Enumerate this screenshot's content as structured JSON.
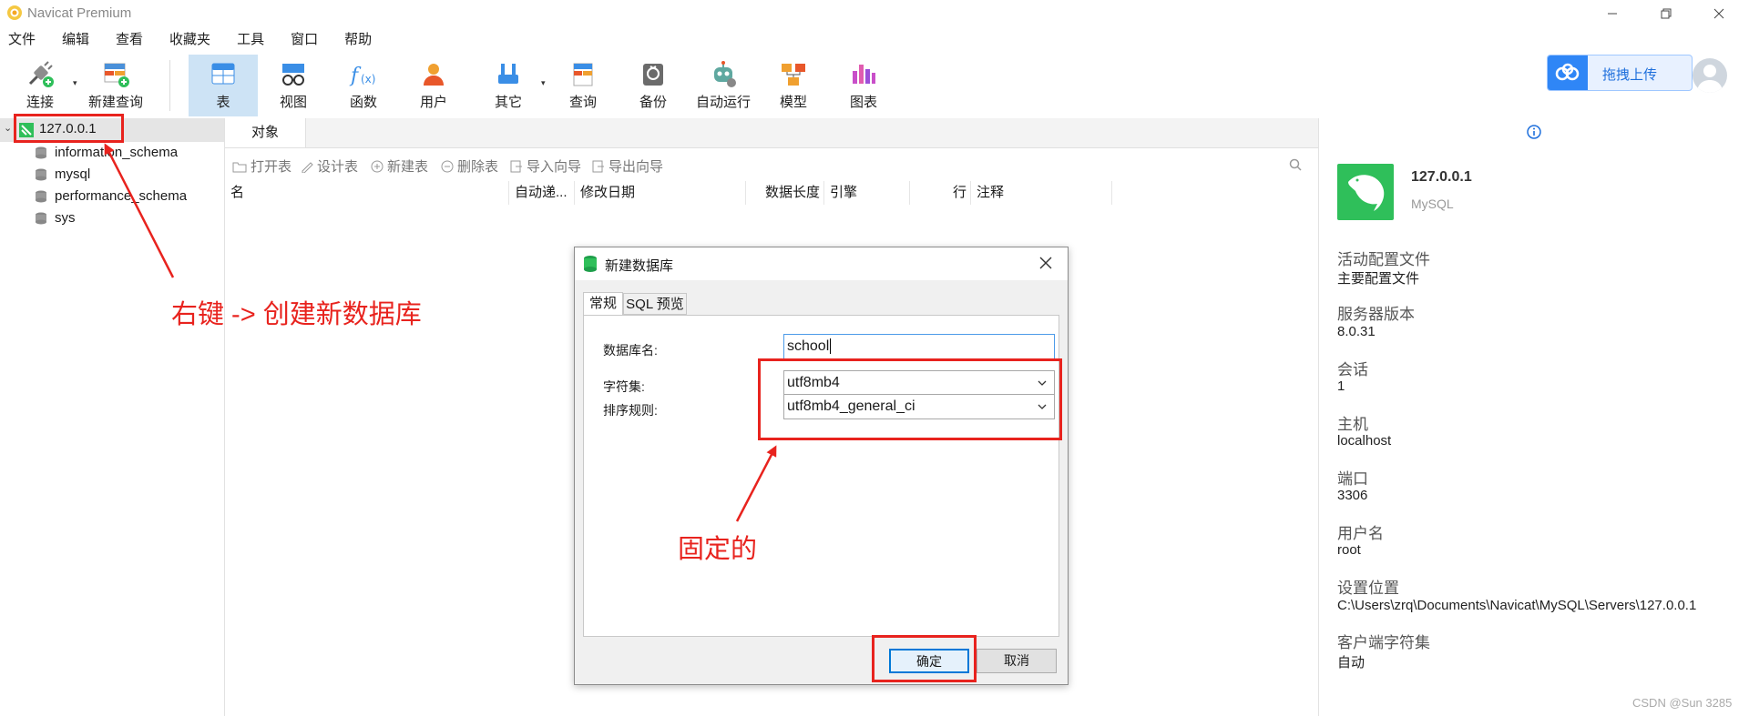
{
  "window": {
    "title": "Navicat Premium"
  },
  "menu": [
    "文件",
    "编辑",
    "查看",
    "收藏夹",
    "工具",
    "窗口",
    "帮助"
  ],
  "toolbar": {
    "buttons": [
      {
        "label": "连接",
        "icon": "connect-icon"
      },
      {
        "label": "新建查询",
        "icon": "new-query-icon"
      },
      {
        "label": "表",
        "icon": "table-icon",
        "active": true
      },
      {
        "label": "视图",
        "icon": "view-icon"
      },
      {
        "label": "函数",
        "icon": "function-icon"
      },
      {
        "label": "用户",
        "icon": "user-icon"
      },
      {
        "label": "其它",
        "icon": "other-tools-icon"
      },
      {
        "label": "查询",
        "icon": "query-icon"
      },
      {
        "label": "备份",
        "icon": "backup-icon"
      },
      {
        "label": "自动运行",
        "icon": "auto-run-icon"
      },
      {
        "label": "模型",
        "icon": "model-icon"
      },
      {
        "label": "图表",
        "icon": "chart-icon"
      }
    ],
    "upload_label": "拖拽上传"
  },
  "tree": {
    "connection": "127.0.0.1",
    "databases": [
      "information_schema",
      "mysql",
      "performance_schema",
      "sys"
    ]
  },
  "objects_tab": "对象",
  "object_toolbar": [
    "打开表",
    "设计表",
    "新建表",
    "删除表",
    "导入向导",
    "导出向导"
  ],
  "columns": [
    "名",
    "自动递...",
    "修改日期",
    "数据长度",
    "引擎",
    "行",
    "注释"
  ],
  "info_panel": {
    "server_name": "127.0.0.1",
    "server_type": "MySQL",
    "properties": [
      {
        "label": "活动配置文件",
        "value": "主要配置文件"
      },
      {
        "label": "服务器版本",
        "value": "8.0.31"
      },
      {
        "label": "会话",
        "value": "1"
      },
      {
        "label": "主机",
        "value": "localhost"
      },
      {
        "label": "端口",
        "value": "3306"
      },
      {
        "label": "用户名",
        "value": "root"
      },
      {
        "label": "设置位置",
        "value": "C:\\Users\\zrq\\Documents\\Navicat\\MySQL\\Servers\\127.0.0.1"
      },
      {
        "label": "客户端字符集",
        "value": "自动"
      }
    ]
  },
  "dialog": {
    "title": "新建数据库",
    "tabs": [
      "常规",
      "SQL 预览"
    ],
    "db_name_label": "数据库名:",
    "db_name_value": "school",
    "charset_label": "字符集:",
    "charset_value": "utf8mb4",
    "collation_label": "排序规则:",
    "collation_value": "utf8mb4_general_ci",
    "ok_label": "确定",
    "cancel_label": "取消"
  },
  "annotations": {
    "right_click_note": "右键 -> 创建新数据库",
    "fixed_note": "固定的",
    "color": "#e8231e"
  },
  "watermark": "CSDN @Sun 3285",
  "colors": {
    "selected_tool_bg": "#cde3f5",
    "accent": "#0078d7",
    "navicat_green": "#2fbf5a"
  }
}
